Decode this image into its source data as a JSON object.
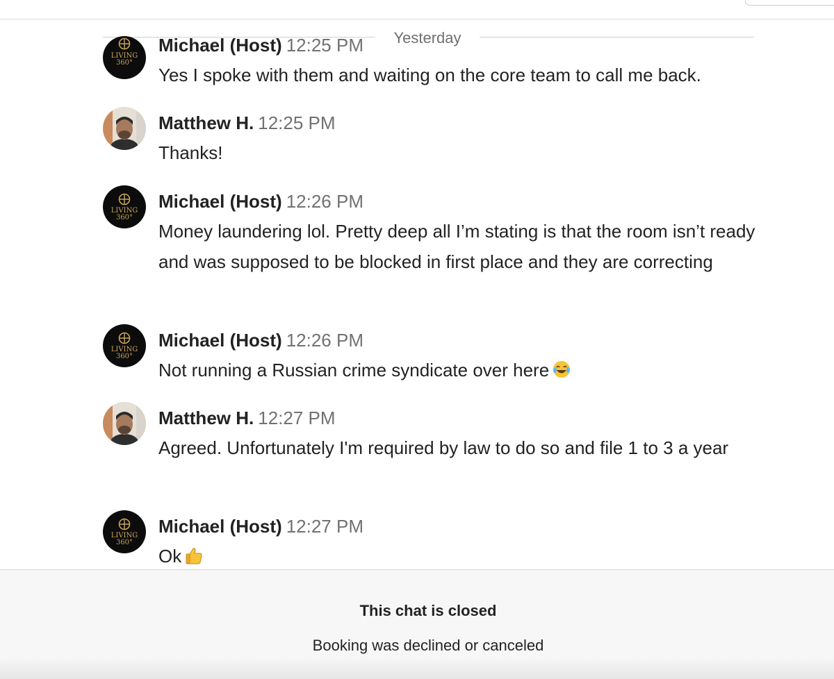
{
  "thread": {
    "date_divider": "Yesterday",
    "messages": [
      {
        "author": "Michael (Host)",
        "avatar": "host-logo-avatar",
        "avatar_text": [
          "LIVING",
          "360°"
        ],
        "time": "12:25 PM",
        "text": "Yes I spoke with them and waiting on the core team to call me back."
      },
      {
        "author": "Matthew H.",
        "avatar": "guest-photo-avatar",
        "time": "12:25 PM",
        "text": "Thanks!"
      },
      {
        "author": "Michael (Host)",
        "avatar": "host-logo-avatar",
        "avatar_text": [
          "LIVING",
          "360°"
        ],
        "time": "12:26 PM",
        "text": "Money laundering lol. Pretty deep all I’m stating is that the room isn’t ready and was supposed to be blocked in first place and they are correcting"
      },
      {
        "author": "Michael (Host)",
        "avatar": "host-logo-avatar",
        "avatar_text": [
          "LIVING",
          "360°"
        ],
        "time": "12:26 PM",
        "text": "Not running a Russian crime syndicate over here",
        "emoji": "face-with-tears-of-joy"
      },
      {
        "author": "Matthew H.",
        "avatar": "guest-photo-avatar",
        "time": "12:27 PM",
        "text": "Agreed. Unfortunately I'm required by law to do so and file 1 to 3 a year"
      },
      {
        "author": "Michael (Host)",
        "avatar": "host-logo-avatar",
        "avatar_text": [
          "LIVING",
          "360°"
        ],
        "time": "12:27 PM",
        "text": "Ok",
        "emoji": "thumbs-up"
      }
    ]
  },
  "footer": {
    "title": "This chat is closed",
    "subtitle": "Booking was declined or canceled"
  },
  "colors": {
    "host_avatar_bg": "#0c0c0c",
    "host_logo_gold": "#c9a45a",
    "timestamp": "#717171",
    "divider": "#cfcfcf"
  }
}
